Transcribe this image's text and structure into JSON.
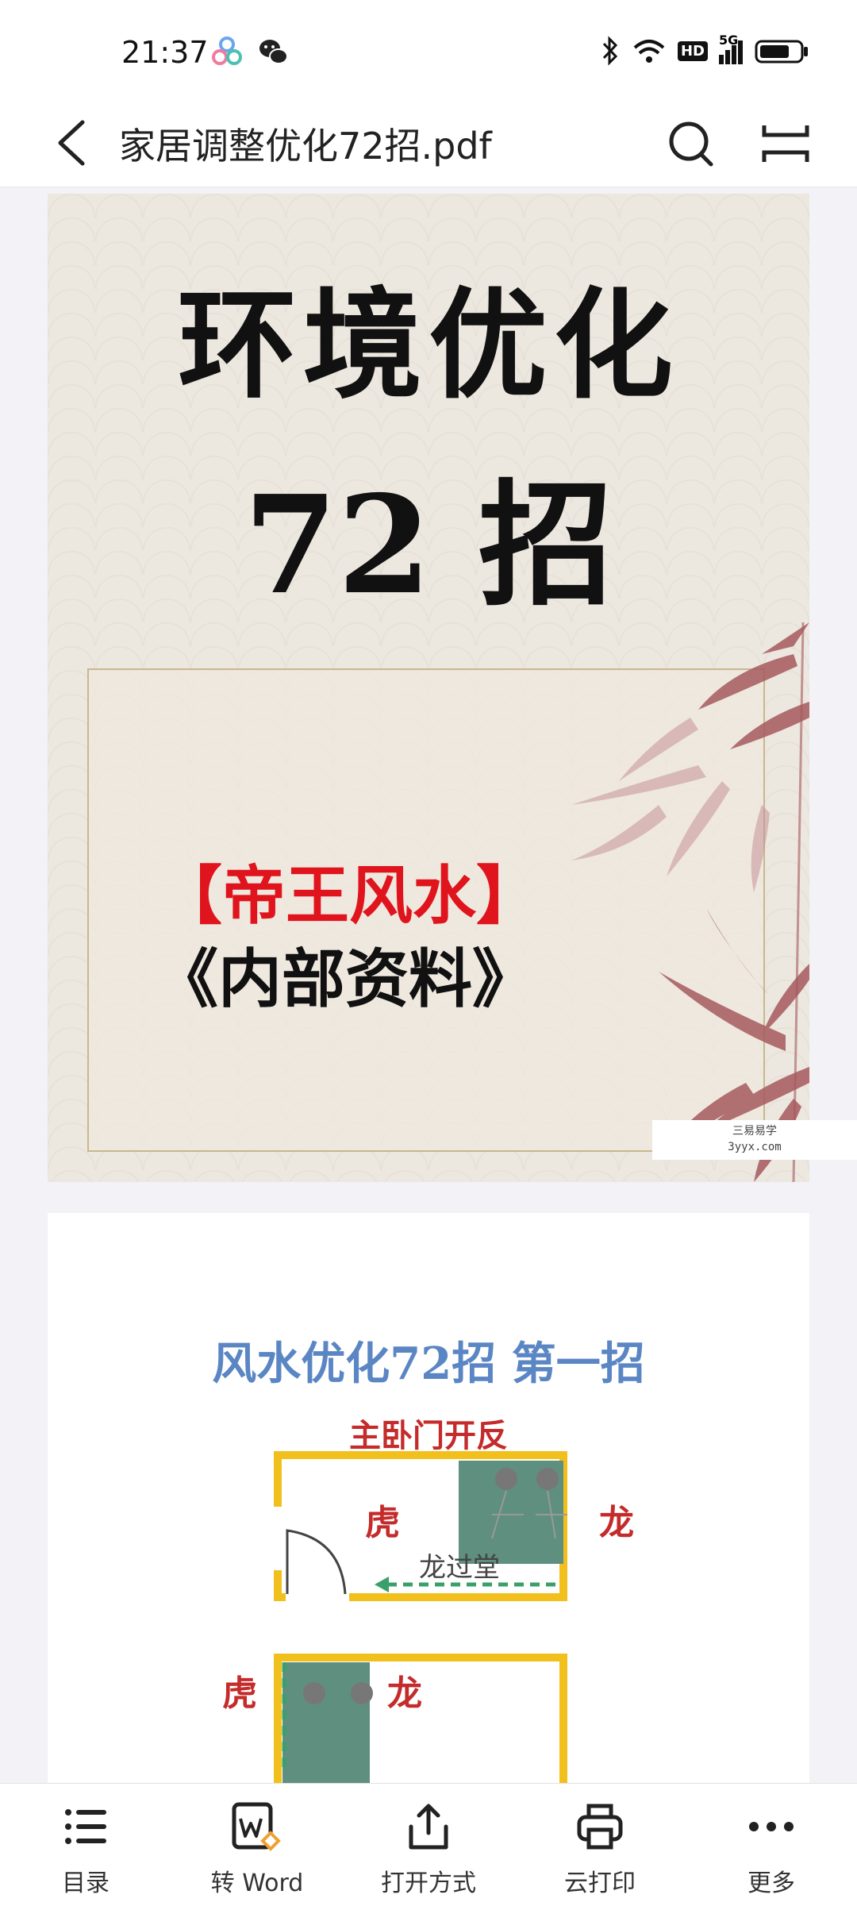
{
  "status": {
    "time": "21:37",
    "network": "5G",
    "hd": "HD"
  },
  "topbar": {
    "title": "家居调整优化72招.pdf"
  },
  "page1": {
    "title_line1": "环境优化",
    "title_line2": "72 招",
    "tag": "【帝王风水】",
    "subtitle": "《内部资料》",
    "watermark_line1": "三易易学",
    "watermark_line2": "3yyx.com"
  },
  "page2": {
    "title": "风水优化72招 第一招",
    "subtitle": "主卧门开反",
    "labels": {
      "tiger": "虎",
      "dragon": "龙",
      "dragon_pass": "龙过堂"
    }
  },
  "toolbar": {
    "items": [
      {
        "label": "目录",
        "icon": "list-icon"
      },
      {
        "label": "转 Word",
        "icon": "convert-word-icon"
      },
      {
        "label": "打开方式",
        "icon": "share-icon"
      },
      {
        "label": "云打印",
        "icon": "printer-icon"
      },
      {
        "label": "更多",
        "icon": "more-icon"
      }
    ]
  },
  "colors": {
    "accent_red": "#e0141c",
    "title_blue": "#5b86c4",
    "wall_yellow": "#f2c01d",
    "bed_green": "#5f8f7f"
  }
}
